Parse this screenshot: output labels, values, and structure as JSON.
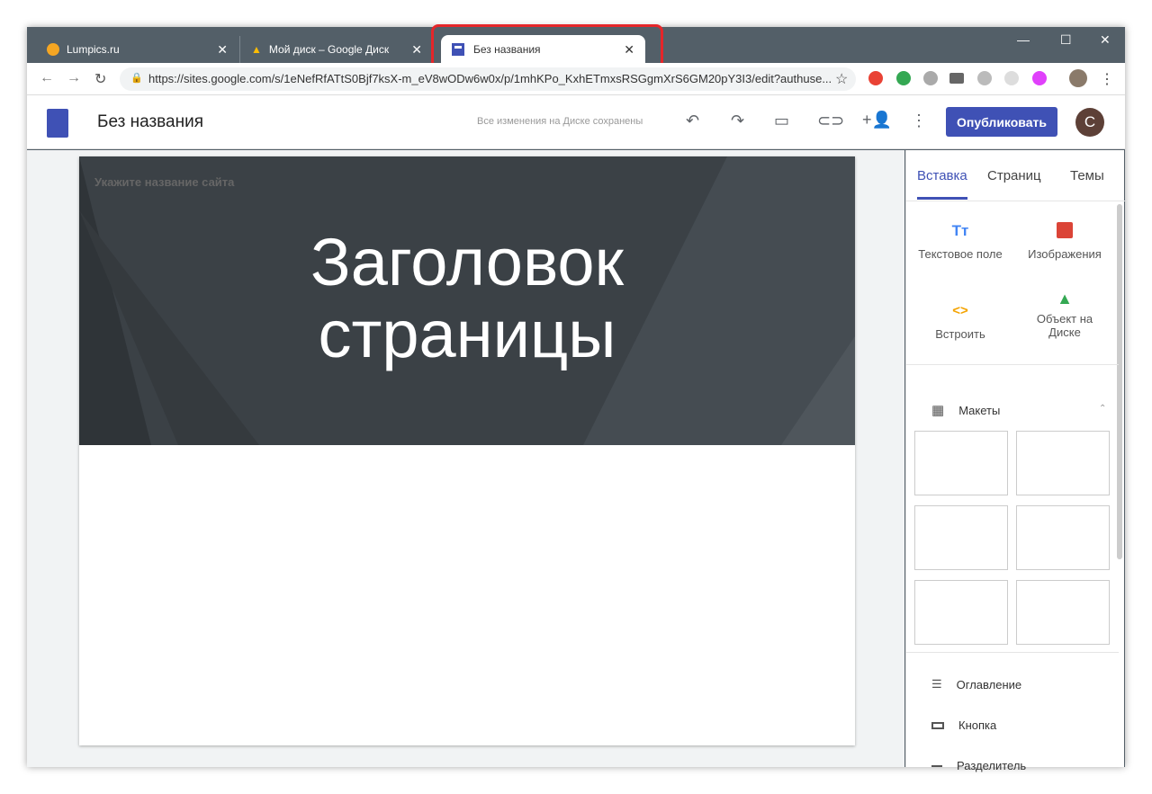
{
  "browser": {
    "tabs": [
      {
        "label": "Lumpics.ru"
      },
      {
        "label": "Мой диск – Google Диск"
      },
      {
        "label": "Без названия",
        "active": true
      }
    ],
    "url": "https://sites.google.com/s/1eNefRfATtS0Bjf7ksX-m_eV8wODw6w0x/p/1mhKPo_KxhETmxsRSGgmXrS6GM20pY3I3/edit?authuse..."
  },
  "app": {
    "title": "Без названия",
    "save_status": "Все изменения на Диске сохранены",
    "publish_label": "Опубликовать",
    "avatar_letter": "C",
    "accent": "#3f51b5"
  },
  "page": {
    "site_name_placeholder": "Укажите название сайта",
    "heading_line1": "Заголовок",
    "heading_line2": "страницы"
  },
  "panel": {
    "tabs": [
      "Вставка",
      "Страниц",
      "Темы"
    ],
    "insert_items": [
      "Текстовое поле",
      "Изображения",
      "Встроить",
      "Объект на Диске"
    ],
    "layouts_label": "Макеты",
    "list_items": [
      "Оглавление",
      "Кнопка",
      "Разделитель"
    ]
  }
}
